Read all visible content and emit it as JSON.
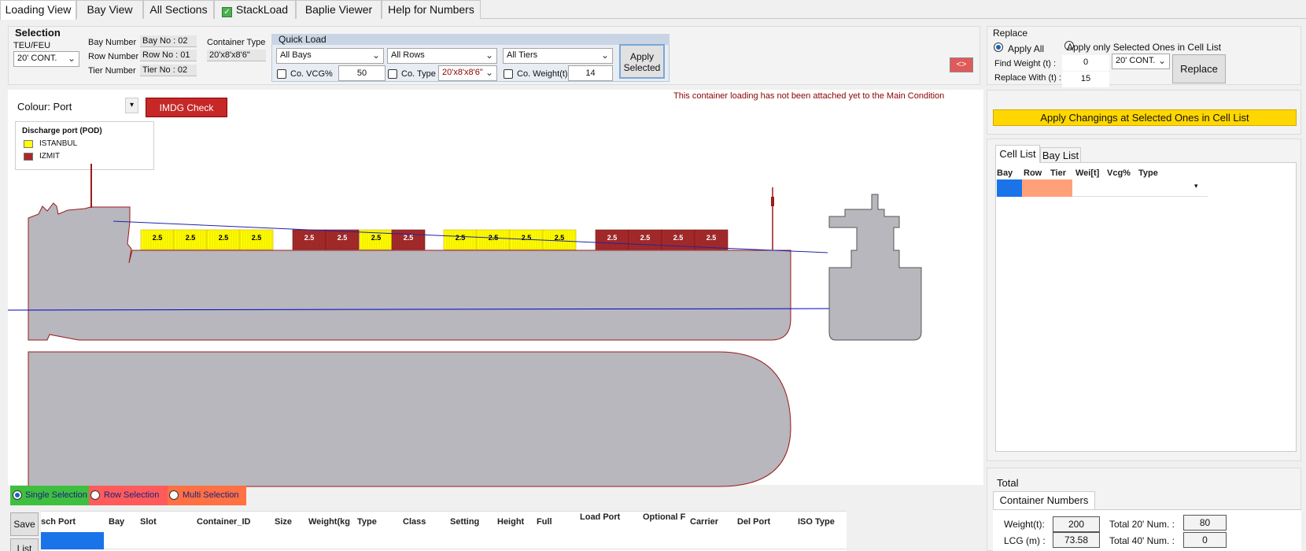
{
  "tabs": [
    "Loading View",
    "Bay View",
    "All Sections",
    "StackLoad",
    "Baplie Viewer",
    "Help for Numbers"
  ],
  "selection": {
    "title": "Selection",
    "teu_feu_label": "TEU/FEU",
    "teu_feu_value": "20' CONT.",
    "bay_label": "Bay Number",
    "bay_value": "Bay No : 02",
    "row_label": "Row Number",
    "row_value": "Row No : 01",
    "tier_label": "Tier Number",
    "tier_value": "Tier No : 02",
    "container_type_label": "Container Type",
    "container_type_value": "20'x8'x8'6\""
  },
  "quick_load": {
    "title": "Quick Load",
    "bays": "All Bays",
    "rows": "All Rows",
    "tiers": "All Tiers",
    "vcg_label": "Co. VCG%",
    "vcg_value": "50",
    "type_label": "Co. Type",
    "type_value": "20'x8'x8'6\"",
    "weight_label": "Co. Weight(t)",
    "weight_value": "14",
    "apply_label": "Apply Selected"
  },
  "toggle_button": "<>",
  "replace": {
    "title": "Replace",
    "apply_all": "Apply All",
    "apply_selected": "Apply only Selected Ones in Cell List",
    "find_label": "Find Weight (t) :",
    "find_value": "0",
    "find_type": "20' CONT.",
    "replace_with_label": "Replace With (t) :",
    "replace_with_value": "15",
    "replace_button": "Replace"
  },
  "colour": {
    "label": "Colour: Port",
    "imdg_button": "IMDG Check"
  },
  "warning": "This container loading has not been attached yet to the Main Condition",
  "legend": {
    "title": "Discharge port (POD)",
    "items": [
      {
        "name": "ISTANBUL",
        "color": "#ffff00"
      },
      {
        "name": "IZMIT",
        "color": "#a52a2a"
      }
    ]
  },
  "container_label": "2.5",
  "apply_changes": "Apply Changings at Selected Ones in Cell List",
  "list_tabs": [
    "Cell List",
    "Bay List"
  ],
  "cell_list_headers": [
    "Bay",
    "Row",
    "Tier",
    "Wei[t]",
    "Vcg%",
    "Type"
  ],
  "selection_modes": [
    "Single Selection",
    "Row Selection",
    "Multi Selection"
  ],
  "buttons": {
    "save": "Save",
    "list": "List"
  },
  "grid_headers": [
    "sch Port",
    "Bay",
    "Slot",
    "Container_ID",
    "Size",
    "Weight(kg",
    "Type",
    "Class",
    "Setting",
    "Height",
    "Full",
    "Load Port",
    "Optional F",
    "Carrier",
    "Del Port",
    "ISO Type"
  ],
  "totals": {
    "title": "Total",
    "tab": "Container Numbers",
    "weight_label": "Weight(t):",
    "weight_value": "200",
    "lcg_label": "LCG (m) :",
    "lcg_value": "73.58",
    "total20_label": "Total 20' Num. :",
    "total20_value": "80",
    "total40_label": "Total 40' Num. :",
    "total40_value": "0"
  },
  "colors": {
    "istanbul": "#ffff00",
    "izmit": "#a52a2a",
    "hull": "#b7b7bd",
    "hull_line": "#9b1b1b",
    "water_line": "#0000cc",
    "imdg": "#c62828",
    "apply_bar": "#ffd700"
  }
}
